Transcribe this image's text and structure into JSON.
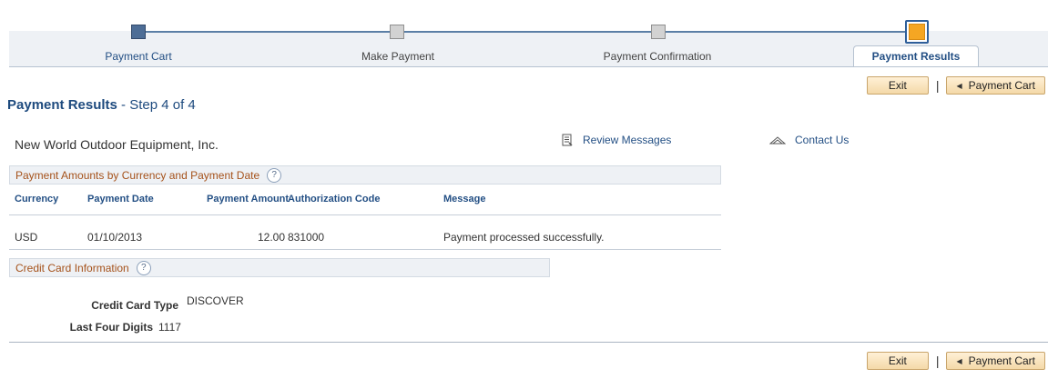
{
  "steps": [
    {
      "label": "Payment Cart",
      "state": "done"
    },
    {
      "label": "Make Payment",
      "state": "todo"
    },
    {
      "label": "Payment Confirmation",
      "state": "todo"
    },
    {
      "label": "Payment Results",
      "state": "current"
    }
  ],
  "buttons": {
    "exit": "Exit",
    "payment_cart": "Payment Cart"
  },
  "title": {
    "main": "Payment Results",
    "step": " - Step 4 of 4"
  },
  "company": "New World Outdoor Equipment, Inc.",
  "links": {
    "review_messages": "Review Messages",
    "contact_us": "Contact Us"
  },
  "payment_section": {
    "title": "Payment Amounts by Currency and Payment Date",
    "columns": [
      "Currency",
      "Payment Date",
      "Payment Amount",
      "Authorization Code",
      "Message"
    ],
    "rows": [
      {
        "currency": "USD",
        "date": "01/10/2013",
        "amount": "12.00",
        "auth_code": "831000",
        "message": "Payment processed successfully."
      }
    ]
  },
  "credit_card": {
    "title": "Credit Card Information",
    "type_label": "Credit Card Type",
    "type_value": "DISCOVER",
    "digits_label": "Last Four Digits",
    "digits_value": "1117"
  },
  "help_glyph": "?",
  "colors": {
    "accent": "#234f84",
    "section_text": "#a5521b",
    "current_step": "#f5a623"
  }
}
